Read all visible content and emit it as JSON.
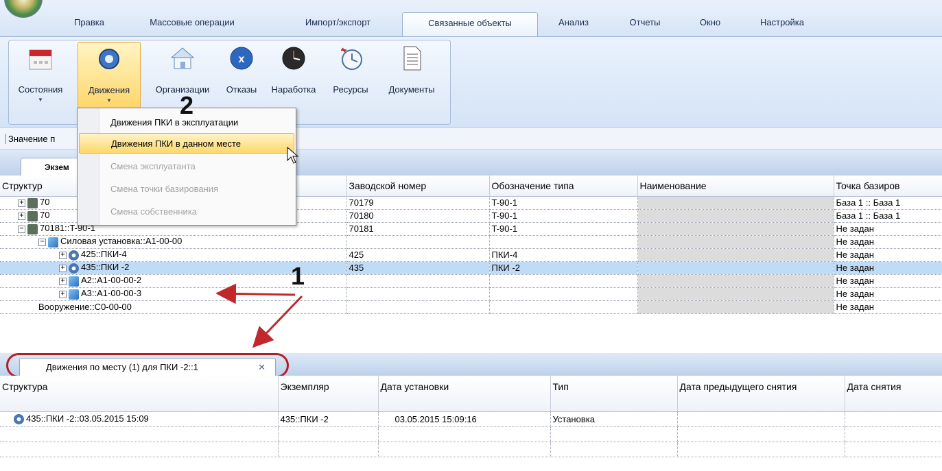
{
  "ribbon_tabs": [
    "Правка",
    "Массовые операции",
    "Импорт/экспорт",
    "Связанные объекты",
    "Анализ",
    "Отчеты",
    "Окно",
    "Настройка"
  ],
  "ribbon_buttons": [
    "Состояния",
    "Движения",
    "Организации",
    "Отказы",
    "Наработка",
    "Ресурсы",
    "Документы"
  ],
  "menu": {
    "items": [
      "Движения ПКИ в эксплуатации",
      "Движения ПКИ в данном месте",
      "Смена эксплуатанта",
      "Смена точки базирования",
      "Смена собственника"
    ]
  },
  "value_strip": "Значение п",
  "doc_tab": "Экзем",
  "top_grid": {
    "headers": [
      "Структур",
      "Заводской номер",
      "Обозначение типа",
      "Наименование",
      "Точка базиров"
    ],
    "rows": [
      {
        "name": "70",
        "serial": "70179",
        "type": "T-90-1",
        "base": "База 1 :: База 1"
      },
      {
        "name": "70",
        "serial": "70180",
        "type": "T-90-1",
        "base": "База 1 :: База 1"
      },
      {
        "name": "70181::T-90-1",
        "serial": "70181",
        "type": "T-90-1",
        "base": "Не задан"
      },
      {
        "name": "Силовая установка::А1-00-00",
        "serial": "",
        "type": "",
        "base": "Не задан"
      },
      {
        "name": "425::ПКИ-4",
        "serial": "425",
        "type": "ПКИ-4",
        "base": "Не задан"
      },
      {
        "name": "435::ПКИ -2",
        "serial": "435",
        "type": "ПКИ -2",
        "base": "Не задан"
      },
      {
        "name": "А2::А1-00-00-2",
        "serial": "",
        "type": "",
        "base": "Не задан"
      },
      {
        "name": "А3::А1-00-00-3",
        "serial": "",
        "type": "",
        "base": "Не задан"
      },
      {
        "name": "Вооружение::С0-00-00",
        "serial": "",
        "type": "",
        "base": "Не задан"
      }
    ]
  },
  "bottom_tab": "Движения по месту (1) для ПКИ -2::1",
  "bottom_grid": {
    "headers": [
      "Структура",
      "Экземпляр",
      "Дата установки",
      "Тип",
      "Дата предыдущего снятия",
      "Дата снятия"
    ],
    "row": {
      "structure": "435::ПКИ -2::03.05.2015 15:09",
      "instance": "435::ПКИ -2",
      "install_date": "03.05.2015 15:09:16",
      "type": "Установка",
      "prev_removal": "",
      "removal": ""
    }
  },
  "annotations": {
    "one": "1",
    "two": "2"
  }
}
